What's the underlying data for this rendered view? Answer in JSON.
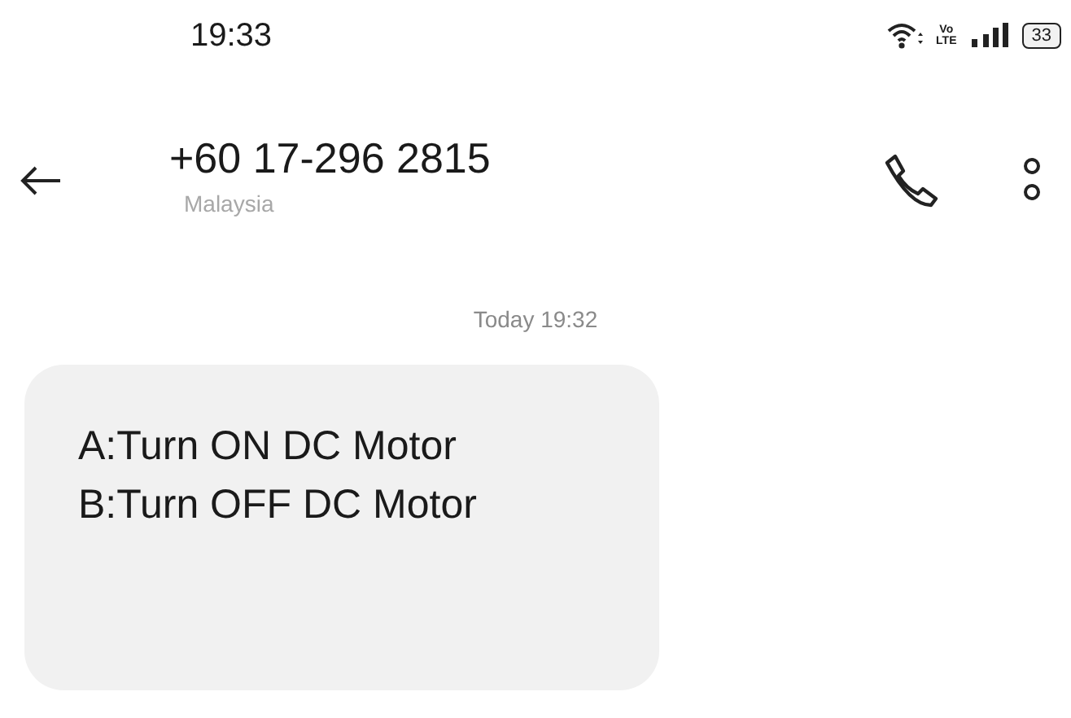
{
  "status_bar": {
    "time": "19:33",
    "network_label": [
      "Vo",
      "LTE"
    ],
    "battery": "33"
  },
  "header": {
    "title": "+60 17-296 2815",
    "subtitle": "Malaysia"
  },
  "timestamp": "Today 19:32",
  "messages": [
    {
      "kind": "incoming",
      "lines": [
        "A:Turn ON DC Motor",
        "B:Turn OFF DC Motor"
      ]
    }
  ]
}
